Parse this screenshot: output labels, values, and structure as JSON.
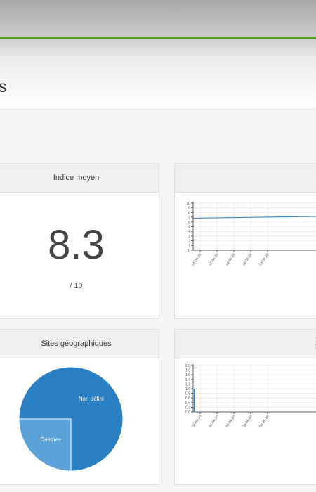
{
  "header": {
    "title_fragment": "s"
  },
  "panels": {
    "average": {
      "title": "Indice moyen",
      "value": "8.3",
      "scale": "/ 10"
    },
    "sites": {
      "title": "Sites géographiques",
      "slices": [
        {
          "label": "Castries",
          "color": "#5aa2d8"
        },
        {
          "label": "Non défini",
          "color": "#2a7fc3"
        }
      ]
    },
    "bottom_right": {
      "title_fragment": "I"
    }
  },
  "chart_data": [
    {
      "type": "line",
      "y_ticks": [
        "0",
        "1",
        "2",
        "3",
        "4",
        "5",
        "6",
        "7",
        "8",
        "9",
        "10"
      ],
      "ylim": [
        0,
        10
      ],
      "x_ticks": [
        "05-04-20",
        "12-04-20",
        "19-04-20",
        "26-04-20",
        "03-05-20"
      ],
      "series": [
        {
          "values": [
            6.8,
            7.2
          ]
        }
      ]
    },
    {
      "type": "bar",
      "y_ticks": [
        "0.0",
        "0.2",
        "0.4",
        "0.6",
        "0.8",
        "1.0",
        "1.2",
        "1.4",
        "1.6",
        "1.8",
        "2.0"
      ],
      "ylim": [
        0,
        2
      ],
      "x_ticks": [
        "05-04-20",
        "12-04-20",
        "19-04-20",
        "26-04-20",
        "03-05-20"
      ],
      "values": [
        1
      ]
    },
    {
      "type": "pie",
      "categories": [
        "Castries",
        "Non défini"
      ],
      "values": [
        25,
        75
      ]
    }
  ]
}
